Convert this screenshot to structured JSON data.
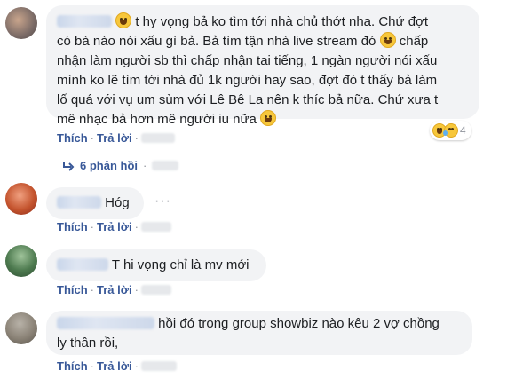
{
  "comments": [
    {
      "lines": [
        "t hy vọng bả ko tìm tới nhà chủ thớt nha. Chứ đợt",
        "có bà nào nói xấu gì bả. Bả tìm tận nhà live stream đó",
        "chấp",
        "nhận làm người sb thì chấp nhận tai tiếng, 1 ngàn người nói xấu",
        "mình ko lẽ tìm tới nhà đủ 1k người hay sao, đợt đó t thấy bả làm",
        "lố quá với vụ um sùm với Lê Bê La nên k thíc bả nữa. Chứ xưa t",
        "mê nhạc bả hơn mê người iu nữa"
      ],
      "like_label": "Thích",
      "reply_label": "Trả lời",
      "reaction_count": "4",
      "replies_label": "6 phản hồi"
    },
    {
      "text": "Hóg",
      "like_label": "Thích",
      "reply_label": "Trả lời",
      "more": "···"
    },
    {
      "text": "T hi vọng chỉ là mv mới",
      "like_label": "Thích",
      "reply_label": "Trả lời"
    },
    {
      "lines": [
        "hồi đó trong group showbiz nào kêu 2 vợ chồng",
        "ly thân rồi,"
      ],
      "like_label": "Thích",
      "reply_label": "Trả lời"
    }
  ],
  "separator": "·",
  "colors": {
    "link": "#385898",
    "bubble": "#f2f3f5",
    "meta": "#90949c"
  },
  "icons": [
    "laughing-tears-emoji",
    "sad-emoji",
    "reply-arrow-icon"
  ]
}
